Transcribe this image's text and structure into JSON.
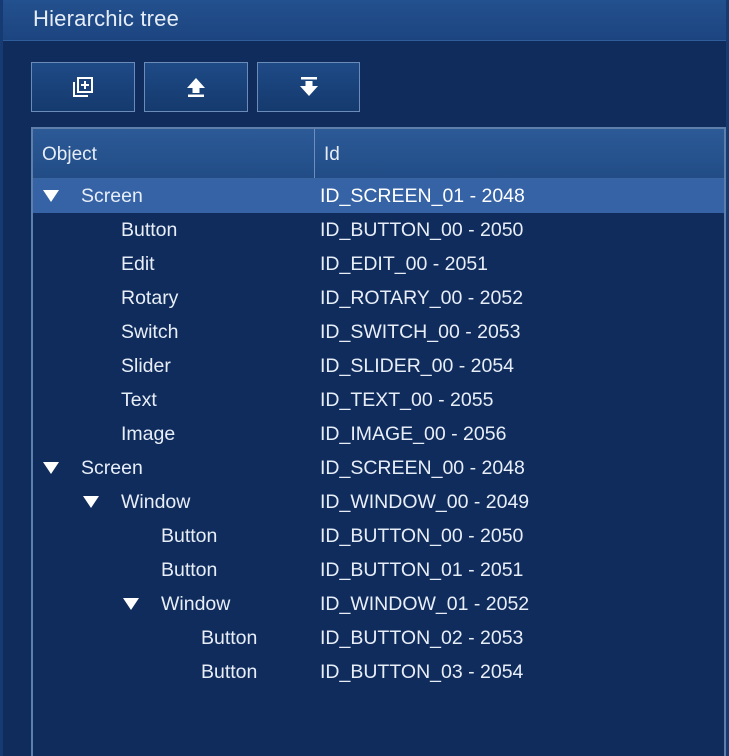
{
  "panel": {
    "title": "Hierarchic tree"
  },
  "toolbar": {
    "buttons": [
      {
        "name": "add-child",
        "icon": "add-copy-icon"
      },
      {
        "name": "move-up",
        "icon": "arrow-up-icon"
      },
      {
        "name": "move-down",
        "icon": "arrow-down-to-line-icon"
      }
    ]
  },
  "tree": {
    "columns": {
      "object": "Object",
      "id": "Id"
    },
    "rows": [
      {
        "object": "Screen",
        "id": "ID_SCREEN_01 - 2048",
        "level": 0,
        "expanded": true,
        "selected": true
      },
      {
        "object": "Button",
        "id": "ID_BUTTON_00 - 2050",
        "level": 1,
        "expanded": false,
        "selected": false
      },
      {
        "object": "Edit",
        "id": "ID_EDIT_00 - 2051",
        "level": 1,
        "expanded": false,
        "selected": false
      },
      {
        "object": "Rotary",
        "id": "ID_ROTARY_00 - 2052",
        "level": 1,
        "expanded": false,
        "selected": false
      },
      {
        "object": "Switch",
        "id": "ID_SWITCH_00 - 2053",
        "level": 1,
        "expanded": false,
        "selected": false
      },
      {
        "object": "Slider",
        "id": "ID_SLIDER_00 - 2054",
        "level": 1,
        "expanded": false,
        "selected": false
      },
      {
        "object": "Text",
        "id": "ID_TEXT_00 - 2055",
        "level": 1,
        "expanded": false,
        "selected": false
      },
      {
        "object": "Image",
        "id": "ID_IMAGE_00 - 2056",
        "level": 1,
        "expanded": false,
        "selected": false
      },
      {
        "object": "Screen",
        "id": "ID_SCREEN_00 - 2048",
        "level": 0,
        "expanded": true,
        "selected": false
      },
      {
        "object": "Window",
        "id": "ID_WINDOW_00 - 2049",
        "level": 1,
        "expanded": true,
        "selected": false
      },
      {
        "object": "Button",
        "id": "ID_BUTTON_00 - 2050",
        "level": 2,
        "expanded": false,
        "selected": false
      },
      {
        "object": "Button",
        "id": "ID_BUTTON_01 - 2051",
        "level": 2,
        "expanded": false,
        "selected": false
      },
      {
        "object": "Window",
        "id": "ID_WINDOW_01 - 2052",
        "level": 2,
        "expanded": true,
        "selected": false
      },
      {
        "object": "Button",
        "id": "ID_BUTTON_02 - 2053",
        "level": 3,
        "expanded": false,
        "selected": false
      },
      {
        "object": "Button",
        "id": "ID_BUTTON_03 - 2054",
        "level": 3,
        "expanded": false,
        "selected": false
      }
    ]
  }
}
